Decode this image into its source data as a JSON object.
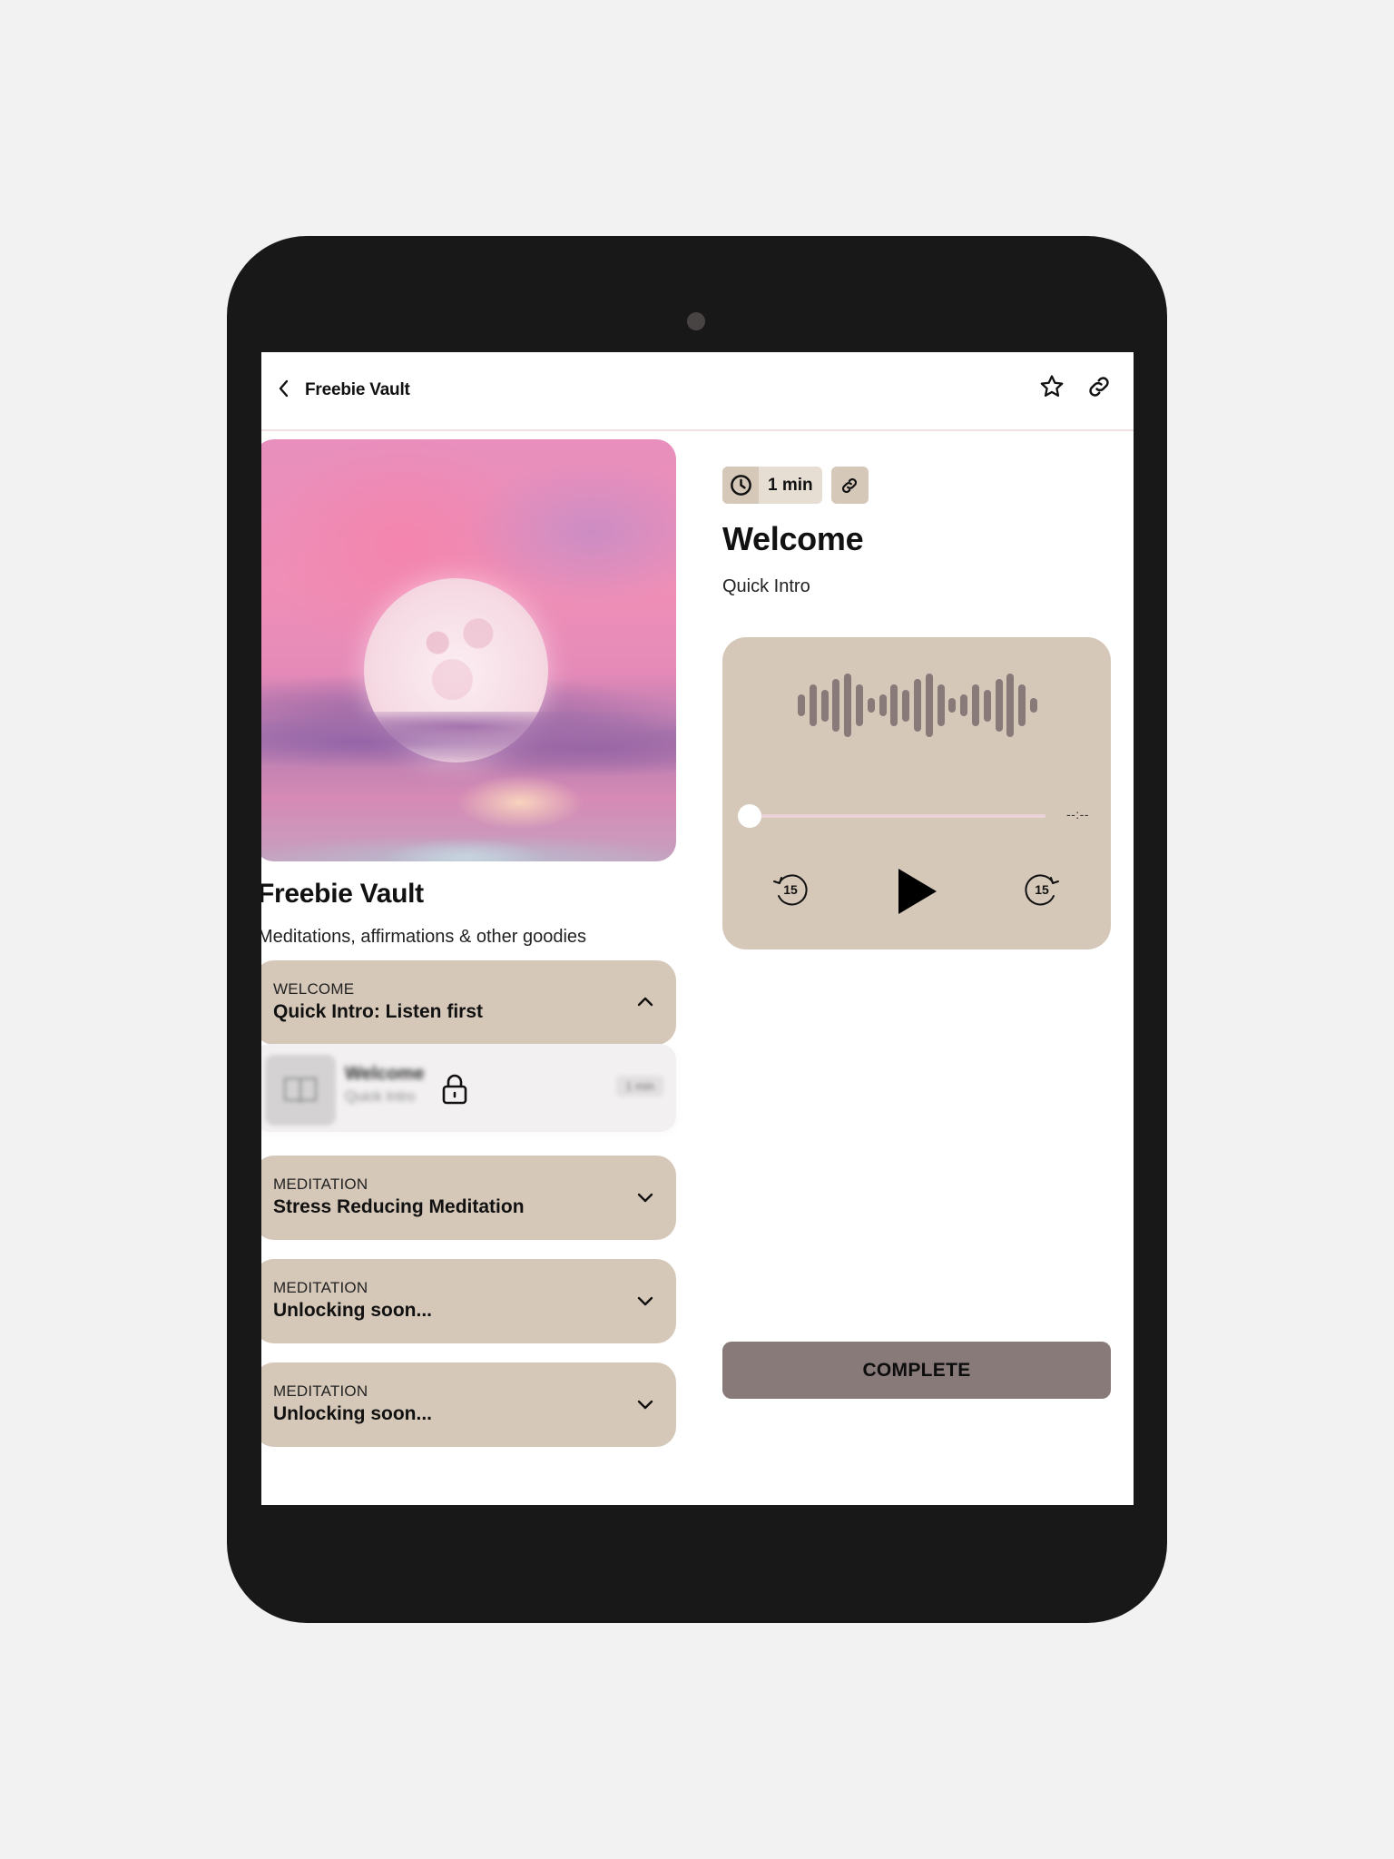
{
  "header": {
    "back_label": "Freebie Vault",
    "favorite_icon": "star-outline-icon",
    "share_icon": "link-icon"
  },
  "library": {
    "artwork_alt": "Pink moon rising over clouds and ocean",
    "title": "Freebie Vault",
    "subtitle": "Meditations, affirmations & other goodies"
  },
  "sections": [
    {
      "kicker": "WELCOME",
      "title": "Quick Intro: Listen first",
      "expanded": true
    },
    {
      "kicker": "MEDITATION",
      "title": "Stress Reducing Meditation",
      "expanded": false
    },
    {
      "kicker": "MEDITATION",
      "title": "Unlocking soon...",
      "expanded": false
    },
    {
      "kicker": "MEDITATION",
      "title": "Unlocking soon...",
      "expanded": false
    }
  ],
  "lesson_row": {
    "title": "Welcome",
    "subtitle": "Quick Intro",
    "duration": "1 min",
    "locked": true
  },
  "lesson": {
    "duration": "1 min",
    "title": "Welcome",
    "subtitle": "Quick Intro"
  },
  "player": {
    "progress": 0,
    "time_label": "--:--",
    "skip_back_label": "15",
    "skip_forward_label": "15",
    "waveform_levels": [
      0.33,
      0.67,
      0.5,
      0.83,
      1.0,
      0.67,
      0.17,
      0.33,
      0.67,
      0.5,
      0.83,
      1.0,
      0.67,
      0.17,
      0.33,
      0.67,
      0.5,
      0.83,
      1.0,
      0.67,
      0.17
    ]
  },
  "actions": {
    "complete_label": "COMPLETE"
  },
  "colors": {
    "accent_beige": "#d6c8b9",
    "chip_light": "#e6ddd3",
    "mauve": "#887a79",
    "track": "#ead3d7",
    "device": "#181818",
    "page_bg": "#f2f2f2"
  }
}
